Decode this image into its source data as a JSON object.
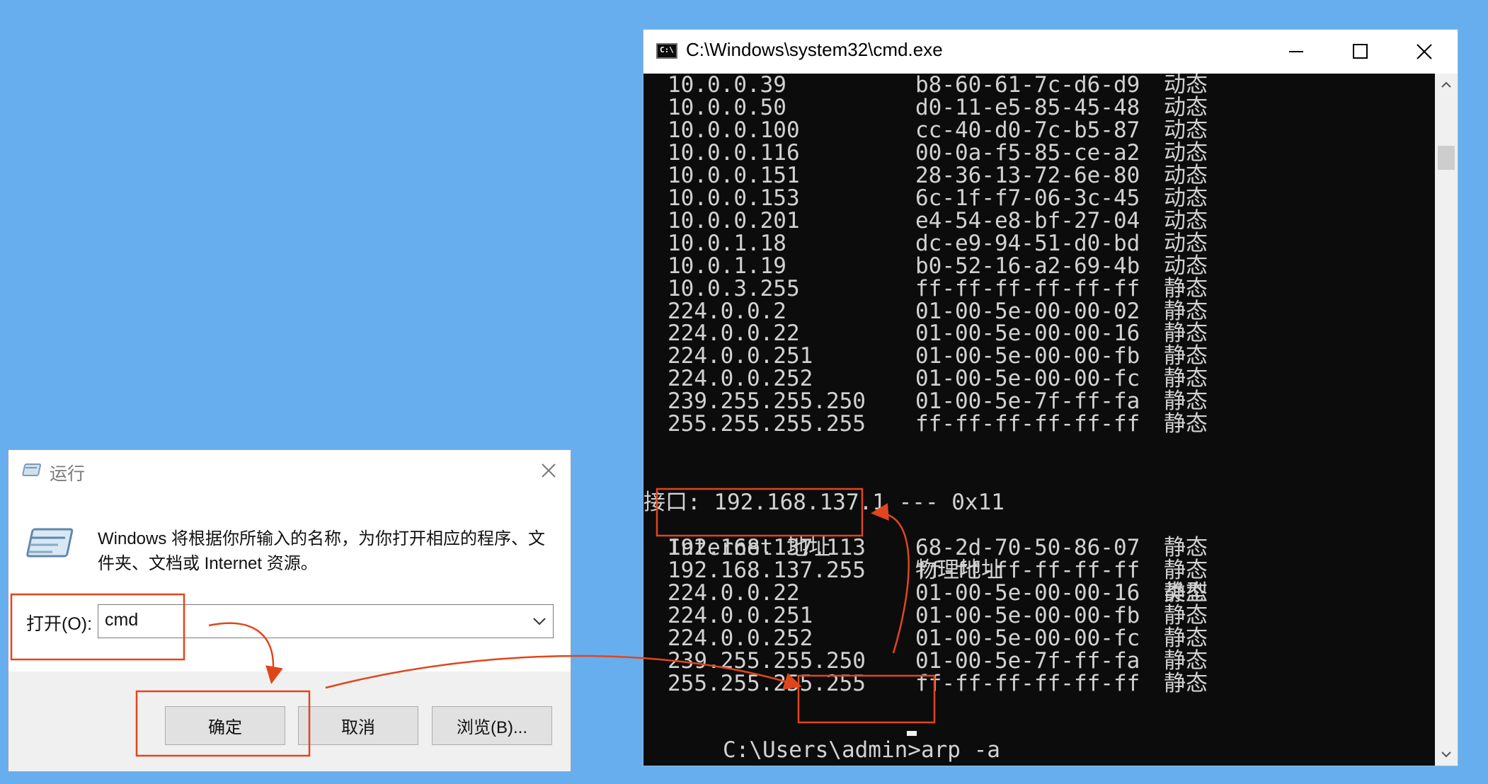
{
  "cmd": {
    "title": "C:\\Windows\\system32\\cmd.exe",
    "icon_text": "C:\\",
    "rows_top": [
      {
        "ip": "10.0.0.39",
        "mac": "b8-60-61-7c-d6-d9",
        "type": "动态"
      },
      {
        "ip": "10.0.0.50",
        "mac": "d0-11-e5-85-45-48",
        "type": "动态"
      },
      {
        "ip": "10.0.0.100",
        "mac": "cc-40-d0-7c-b5-87",
        "type": "动态"
      },
      {
        "ip": "10.0.0.116",
        "mac": "00-0a-f5-85-ce-a2",
        "type": "动态"
      },
      {
        "ip": "10.0.0.151",
        "mac": "28-36-13-72-6e-80",
        "type": "动态"
      },
      {
        "ip": "10.0.0.153",
        "mac": "6c-1f-f7-06-3c-45",
        "type": "动态"
      },
      {
        "ip": "10.0.0.201",
        "mac": "e4-54-e8-bf-27-04",
        "type": "动态"
      },
      {
        "ip": "10.0.1.18",
        "mac": "dc-e9-94-51-d0-bd",
        "type": "动态"
      },
      {
        "ip": "10.0.1.19",
        "mac": "b0-52-16-a2-69-4b",
        "type": "动态"
      },
      {
        "ip": "10.0.3.255",
        "mac": "ff-ff-ff-ff-ff-ff",
        "type": "静态"
      },
      {
        "ip": "224.0.0.2",
        "mac": "01-00-5e-00-00-02",
        "type": "静态"
      },
      {
        "ip": "224.0.0.22",
        "mac": "01-00-5e-00-00-16",
        "type": "静态"
      },
      {
        "ip": "224.0.0.251",
        "mac": "01-00-5e-00-00-fb",
        "type": "静态"
      },
      {
        "ip": "224.0.0.252",
        "mac": "01-00-5e-00-00-fc",
        "type": "静态"
      },
      {
        "ip": "239.255.255.250",
        "mac": "01-00-5e-7f-ff-fa",
        "type": "静态"
      },
      {
        "ip": "255.255.255.255",
        "mac": "ff-ff-ff-ff-ff-ff",
        "type": "静态"
      }
    ],
    "interface_line": "接口: 192.168.137.1 --- 0x11",
    "headers": {
      "ip": "Internet 地址",
      "mac": "物理地址",
      "type": "类型"
    },
    "rows_bottom": [
      {
        "ip": "192.168.137.113",
        "mac": "68-2d-70-50-86-07",
        "type": "静态"
      },
      {
        "ip": "192.168.137.255",
        "mac": "ff-ff-ff-ff-ff-ff",
        "type": "静态"
      },
      {
        "ip": "224.0.0.22",
        "mac": "01-00-5e-00-00-16",
        "type": "静态"
      },
      {
        "ip": "224.0.0.251",
        "mac": "01-00-5e-00-00-fb",
        "type": "静态"
      },
      {
        "ip": "224.0.0.252",
        "mac": "01-00-5e-00-00-fc",
        "type": "静态"
      },
      {
        "ip": "239.255.255.250",
        "mac": "01-00-5e-7f-ff-fa",
        "type": "静态"
      },
      {
        "ip": "255.255.255.255",
        "mac": "ff-ff-ff-ff-ff-ff",
        "type": "静态"
      }
    ],
    "prompt_path": "C:\\Users\\admin>",
    "prompt_command": "arp -a"
  },
  "run": {
    "title": "运行",
    "message": "Windows 将根据你所输入的名称，为你打开相应的程序、文件夹、文档或 Internet 资源。",
    "open_label": "打开(O):",
    "input_value": "cmd",
    "ok_label": "确定",
    "cancel_label": "取消",
    "browse_label": "浏览(B)..."
  },
  "colors": {
    "desktop": "#67aeef",
    "console_bg": "#0c0c0c",
    "console_text": "#d2d2d2",
    "annotation": "#e0461c"
  }
}
